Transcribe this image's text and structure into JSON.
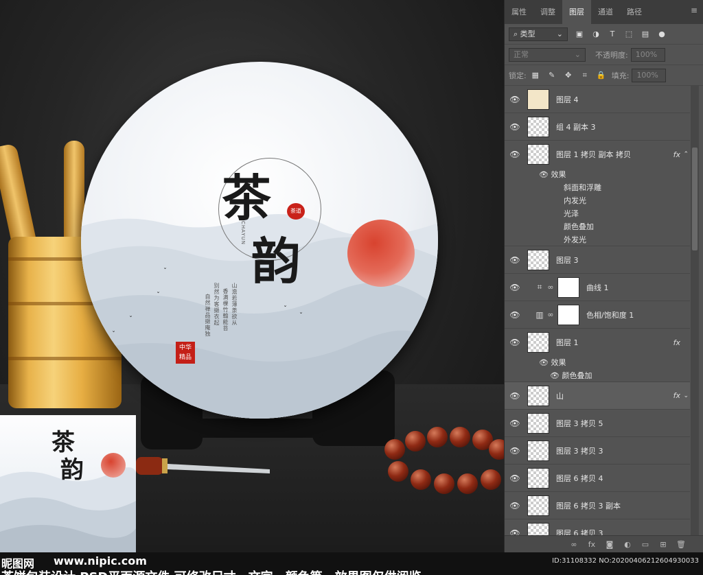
{
  "panel": {
    "tabs": [
      "属性",
      "调整",
      "图层",
      "通道",
      "路径"
    ],
    "active_tab": "图层",
    "filter": {
      "kind_label": "类型"
    },
    "blend_mode": "正常",
    "opacity_label": "不透明度:",
    "opacity_value": "100%",
    "lock_label": "锁定:",
    "fill_label": "填充:",
    "fill_value": "100%",
    "layers": [
      {
        "name": "图层 4"
      },
      {
        "name": "组 4 副本 3"
      },
      {
        "name": "图层 1 拷贝 副本 拷贝",
        "fx": "fx"
      },
      {
        "name": "图层 3"
      },
      {
        "name": "曲线 1"
      },
      {
        "name": "色相/饱和度 1"
      },
      {
        "name": "图层 1",
        "fx": "fx"
      },
      {
        "name": "山",
        "fx": "fx"
      },
      {
        "name": "图层 3 拷贝 5"
      },
      {
        "name": "图层 3 拷贝 3"
      },
      {
        "name": "图层 6 拷贝 4"
      },
      {
        "name": "图层 6 拷贝 3 副本"
      },
      {
        "name": "图层 6 拷贝 3"
      }
    ],
    "effects_label": "效果",
    "effects_layer3copy": [
      "斜面和浮雕",
      "内发光",
      "光泽",
      "颜色叠加",
      "外发光"
    ],
    "effects_layer1": [
      "颜色叠加"
    ]
  },
  "artwork": {
    "char1": "茶",
    "char2": "韵",
    "small_stamp": "茶道",
    "pinyin": "CHAYUN",
    "big_stamp_line1": "中华",
    "big_stamp_line2": "精品",
    "poem": [
      "山澹若薄荼欲从",
      "香满棵竹翰能苔",
      "别然为客撷衣起",
      "自然禅品撷庵独"
    ]
  },
  "footer": {
    "logo": "昵图网",
    "url": "www.nipic.com",
    "id_text": "ID:31108332 NO:20200406212604930033",
    "caption": "茶饼包装设计 PSD平面源文件 可修改尺寸、文字、颜色等，效果图仅供阅览"
  }
}
